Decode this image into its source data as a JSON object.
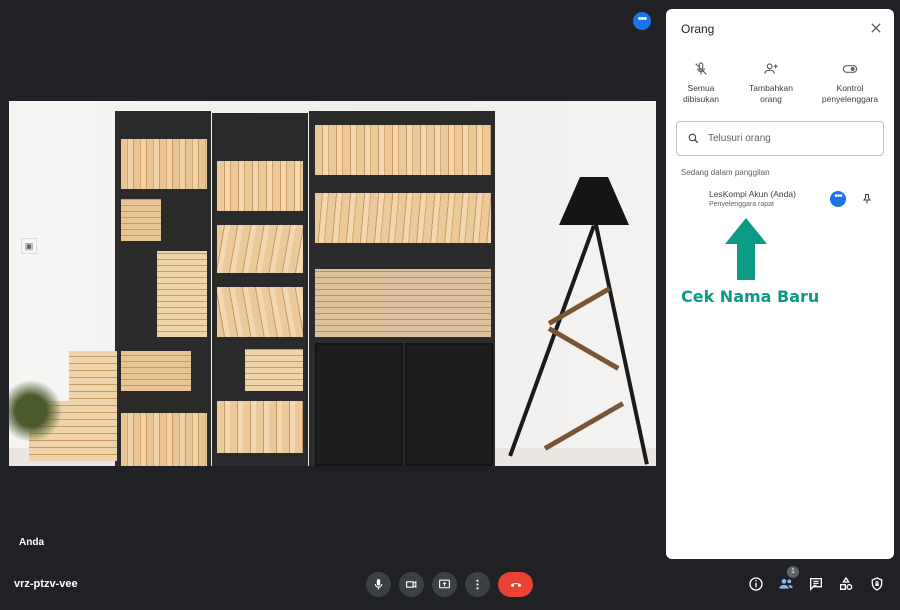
{
  "video": {
    "self_label": "Anda"
  },
  "bottom_bar": {
    "meeting_code": "vrz-ptzv-vee",
    "controls": [
      "mic-icon",
      "camera-icon",
      "present-icon",
      "more-vert-icon",
      "hangup-icon"
    ],
    "right_icons": [
      "info-icon",
      "people-icon",
      "chat-icon",
      "activities-icon",
      "host-controls-icon"
    ],
    "people_count": "1"
  },
  "panel": {
    "title": "Orang",
    "actions": [
      {
        "label_1": "Semua",
        "label_2": "dibisukan",
        "icon": "mic-off-icon"
      },
      {
        "label_1": "Tambahkan",
        "label_2": "orang",
        "icon": "add-person-icon"
      },
      {
        "label_1": "Kontrol",
        "label_2": "penyelenggara",
        "icon": "toggle-icon"
      }
    ],
    "search_placeholder": "Telusuri orang",
    "section_label": "Sedang dalam panggilan",
    "participant": {
      "name": "LesKompi Akun (Anda)",
      "role": "Penyelenggara rapat"
    }
  },
  "annotation": {
    "text": "Cek Nama Baru",
    "color": "#0b9a84"
  },
  "colors": {
    "background": "#202124",
    "accent": "#1a73e8",
    "hangup": "#ea4335",
    "panel": "#ffffff"
  }
}
